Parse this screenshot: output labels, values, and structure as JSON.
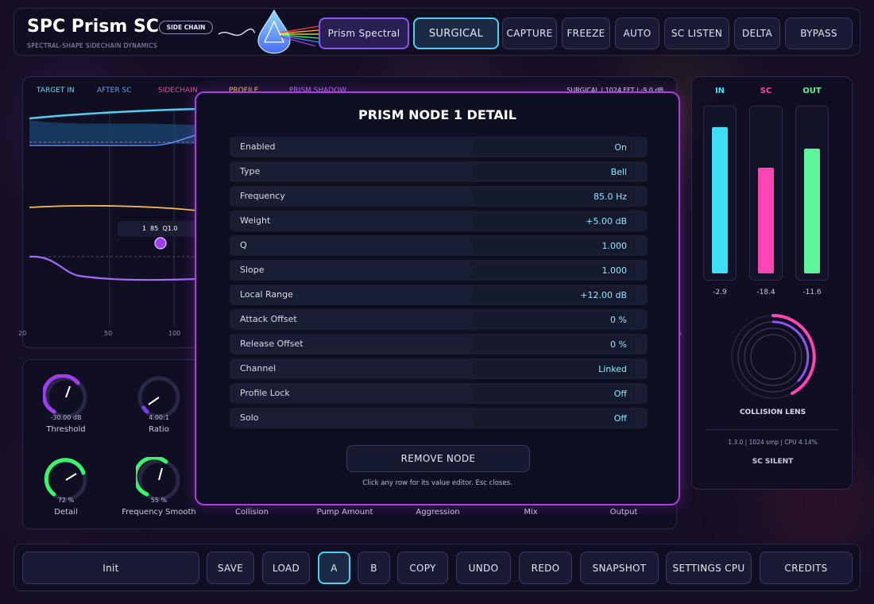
{
  "header": {
    "title": "SPC Prism SC",
    "subtitle": "SPECTRAL-SHAPE SIDECHAIN DYNAMICS",
    "badge": "SIDE CHAIN",
    "buttons": [
      {
        "label": "Prism Spectral"
      },
      {
        "label": "SURGICAL"
      },
      {
        "label": "CAPTURE"
      },
      {
        "label": "FREEZE"
      },
      {
        "label": "AUTO"
      },
      {
        "label": "SC LISTEN"
      },
      {
        "label": "DELTA"
      },
      {
        "label": "BYPASS"
      }
    ]
  },
  "analyzer": {
    "legend": [
      "TARGET IN",
      "AFTER SC",
      "SIDECHAIN",
      "PROFILE",
      "PRISM SHADOW"
    ],
    "status_right": "SURGICAL | 1024 FFT | -9.0 dB",
    "node_tag": "1  85  Q1.0",
    "x_ticks": [
      "20",
      "50",
      "100"
    ],
    "x_tick_right": "k"
  },
  "knobs": [
    {
      "label": "Threshold",
      "value": "-30.00 dB",
      "level": 0.55
    },
    {
      "label": "Ratio",
      "value": "4.00:1",
      "level": 0.08
    },
    {
      "label": "Detail",
      "value": "72 %",
      "level": 0.72
    },
    {
      "label": "Frequency Smooth",
      "value": "55 %",
      "level": 0.55
    }
  ],
  "bottom_labels": [
    "Collision",
    "Pump Amount",
    "Aggression",
    "Mix",
    "Output"
  ],
  "meters": {
    "in": {
      "label": "IN",
      "value": "-2.9",
      "level": 0.9
    },
    "sc": {
      "label": "SC",
      "value": "-18.4",
      "level": 0.65
    },
    "out": {
      "label": "OUT",
      "value": "-11.6",
      "level": 0.77
    },
    "lens_label": "COLLISION LENS",
    "info": "1.3.0 | 1024 smp | CPU 4.14%",
    "sc_status": "SC SILENT"
  },
  "modal": {
    "title": "PRISM NODE 1 DETAIL",
    "rows": [
      {
        "key": "Enabled",
        "value": "On"
      },
      {
        "key": "Type",
        "value": "Bell"
      },
      {
        "key": "Frequency",
        "value": "85.0 Hz"
      },
      {
        "key": "Weight",
        "value": "+5.00 dB"
      },
      {
        "key": "Q",
        "value": "1.000"
      },
      {
        "key": "Slope",
        "value": "1.000"
      },
      {
        "key": "Local Range",
        "value": "+12.00 dB"
      },
      {
        "key": "Attack Offset",
        "value": "0 %"
      },
      {
        "key": "Release Offset",
        "value": "0 %"
      },
      {
        "key": "Channel",
        "value": "Linked"
      },
      {
        "key": "Profile Lock",
        "value": "Off"
      },
      {
        "key": "Solo",
        "value": "Off"
      }
    ],
    "remove_label": "REMOVE NODE",
    "hint": "Click any row for its value editor. Esc closes."
  },
  "footer": {
    "preset": "Init",
    "buttons": [
      "SAVE",
      "LOAD",
      "A",
      "B",
      "COPY",
      "UNDO",
      "REDO",
      "SNAPSHOT",
      "SETTINGS CPU",
      "CREDITS"
    ]
  },
  "colors": {
    "cyan": "#3fe0f5",
    "pink": "#ff44b4",
    "green": "#5ef59a",
    "purple": "#a13cf0",
    "accent_border": "#b03ce0"
  }
}
